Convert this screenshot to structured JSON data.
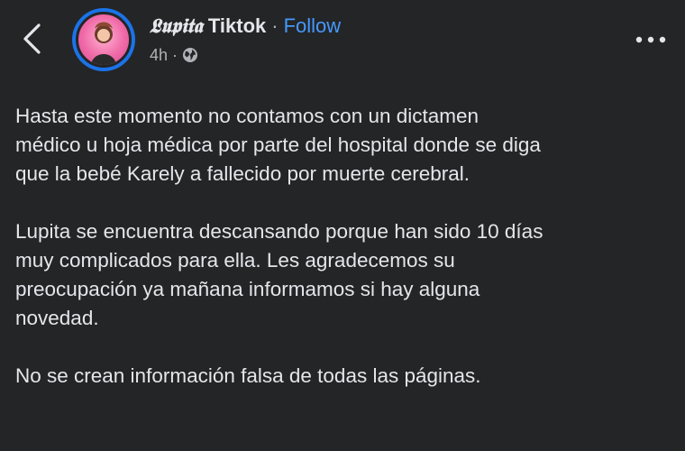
{
  "post": {
    "author": {
      "name_fancy": "𝕷𝖚𝖕𝖎𝖙𝖆",
      "name_plain": "Tiktok",
      "follow_label": "Follow",
      "separator": "·"
    },
    "meta": {
      "time": "4h",
      "separator": "·",
      "audience_icon": "globe-icon"
    },
    "paragraphs": [
      "Hasta este momento no contamos con un dictamen\nmédico u hoja médica por parte del hospital donde se diga\nque la bebé Karely a fallecido por muerte cerebral.",
      "Lupita se encuentra descansando porque han sido 10 días\nmuy complicados para ella. Les agradecemos su\npreocupación ya mañana informamos si hay alguna\nnovedad.",
      "No se crean información falsa de todas las páginas."
    ]
  },
  "icons": {
    "back": "chevron-left-icon",
    "more": "more-horizontal-icon"
  },
  "colors": {
    "background": "#242526",
    "text": "#e4e6eb",
    "muted": "#b0b3b8",
    "link": "#4599ff",
    "avatar_ring": "#1b73e8"
  }
}
